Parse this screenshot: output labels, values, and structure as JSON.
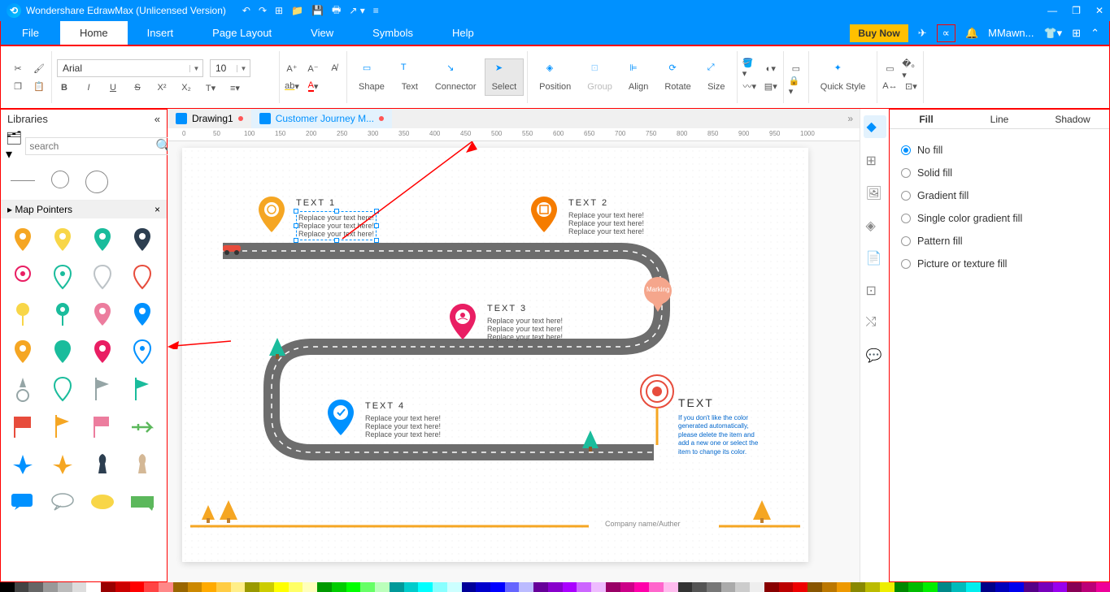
{
  "app": {
    "title": "Wondershare EdrawMax (Unlicensed Version)"
  },
  "menu": {
    "file": "File",
    "home": "Home",
    "insert": "Insert",
    "page": "Page Layout",
    "view": "View",
    "symbols": "Symbols",
    "help": "Help",
    "buy": "Buy Now",
    "user": "MMawn..."
  },
  "ribbon": {
    "font": "Arial",
    "size": "10",
    "shape": "Shape",
    "text": "Text",
    "connector": "Connector",
    "select": "Select",
    "position": "Position",
    "group": "Group",
    "align": "Align",
    "rotate": "Rotate",
    "sizeBtn": "Size",
    "quick": "Quick Style"
  },
  "doc_tabs": {
    "t1": "Drawing1",
    "t2": "Customer Journey M..."
  },
  "ruler": [
    "0",
    "50",
    "100",
    "150",
    "200",
    "250",
    "300",
    "350",
    "400",
    "450",
    "500",
    "550",
    "600",
    "650",
    "700",
    "750",
    "800",
    "850",
    "900",
    "950",
    "1000"
  ],
  "library": {
    "title": "Libraries",
    "search": "search",
    "section": "Map Pointers"
  },
  "canvas": {
    "t1": "TEXT  1",
    "t2": "TEXT  2",
    "t3": "TEXT  3",
    "t4": "TEXT  4",
    "t5": "TEXT",
    "r1": "Replace your text here!",
    "r2": "Replace your text here!",
    "r3": "Replace your text here!",
    "marking": "Marking",
    "note": "If you don't like the color generated automatically, please delete the item and add a new one or select the item to change its color.",
    "company": "Company name/Auther"
  },
  "right": {
    "fill": "Fill",
    "line": "Line",
    "shadow": "Shadow",
    "nofill": "No fill",
    "solid": "Solid fill",
    "grad": "Gradient fill",
    "single": "Single color gradient fill",
    "pattern": "Pattern fill",
    "pic": "Picture or texture fill"
  },
  "palette": [
    "#000",
    "#444",
    "#666",
    "#999",
    "#bbb",
    "#ddd",
    "#fff",
    "#900",
    "#c00",
    "#f00",
    "#f44",
    "#f88",
    "#960",
    "#c80",
    "#fa0",
    "#fc4",
    "#fe8",
    "#990",
    "#cc0",
    "#ff0",
    "#ff6",
    "#ffb",
    "#090",
    "#0c0",
    "#0f0",
    "#6f6",
    "#bfb",
    "#099",
    "#0cc",
    "#0ff",
    "#8ff",
    "#cff",
    "#009",
    "#00c",
    "#00f",
    "#66f",
    "#bbf",
    "#609",
    "#80c",
    "#a0f",
    "#c6f",
    "#ebf",
    "#906",
    "#c08",
    "#f0a",
    "#f6c",
    "#fbe",
    "#333",
    "#555",
    "#777",
    "#aaa",
    "#ccc",
    "#eee",
    "#800",
    "#b00",
    "#e00",
    "#850",
    "#b70",
    "#e90",
    "#880",
    "#bb0",
    "#ee0",
    "#080",
    "#0b0",
    "#0e0",
    "#088",
    "#0bb",
    "#0ee",
    "#008",
    "#00b",
    "#00e",
    "#508",
    "#70b",
    "#90e",
    "#805",
    "#b07",
    "#e09"
  ]
}
